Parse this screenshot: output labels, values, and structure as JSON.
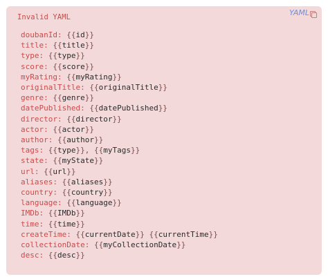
{
  "block": {
    "error_label": "Invalid YAML",
    "language_label": "YAML",
    "copy_icon": "copy-icon"
  },
  "lines": [
    {
      "key": "doubanId",
      "vars": [
        "id"
      ]
    },
    {
      "key": "title",
      "vars": [
        "title"
      ]
    },
    {
      "key": "type",
      "vars": [
        "type"
      ]
    },
    {
      "key": "score",
      "vars": [
        "score"
      ]
    },
    {
      "key": "myRating",
      "vars": [
        "myRating"
      ]
    },
    {
      "key": "originalTitle",
      "vars": [
        "originalTitle"
      ]
    },
    {
      "key": "genre",
      "vars": [
        "genre"
      ]
    },
    {
      "key": "datePublished",
      "vars": [
        "datePublished"
      ]
    },
    {
      "key": "director",
      "vars": [
        "director"
      ]
    },
    {
      "key": "actor",
      "vars": [
        "actor"
      ]
    },
    {
      "key": "author",
      "vars": [
        "author"
      ]
    },
    {
      "key": "tags",
      "vars": [
        "type",
        "myTags"
      ],
      "joiner": ", "
    },
    {
      "key": "state",
      "vars": [
        "myState"
      ]
    },
    {
      "key": "url",
      "vars": [
        "url"
      ]
    },
    {
      "key": "aliases",
      "vars": [
        "aliases"
      ]
    },
    {
      "key": "country",
      "vars": [
        "country"
      ]
    },
    {
      "key": "language",
      "vars": [
        "language"
      ]
    },
    {
      "key": "IMDb",
      "vars": [
        "IMDb"
      ]
    },
    {
      "key": "time",
      "vars": [
        "time"
      ]
    },
    {
      "key": "createTime",
      "vars": [
        "currentDate",
        "currentTime"
      ],
      "joiner": " "
    },
    {
      "key": "collectionDate",
      "vars": [
        "myCollectionDate"
      ]
    },
    {
      "key": "desc",
      "vars": [
        "desc"
      ]
    }
  ]
}
